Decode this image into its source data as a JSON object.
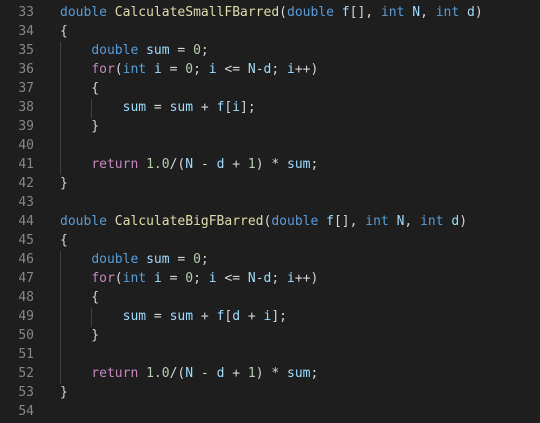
{
  "colors": {
    "background": "#1e1e1e",
    "line_number": "#858585",
    "keyword": "#569cd6",
    "control": "#c586c0",
    "function": "#dcdcaa",
    "variable": "#9cdcfe",
    "number": "#b5cea8",
    "plain": "#d4d4d4"
  },
  "lines": [
    {
      "num": "33",
      "tokens": [
        [
          "double",
          "keyword"
        ],
        [
          " ",
          "plain"
        ],
        [
          "CalculateSmallFBarred",
          "function"
        ],
        [
          "(",
          "plain"
        ],
        [
          "double",
          "keyword"
        ],
        [
          " ",
          "plain"
        ],
        [
          "f",
          "variable"
        ],
        [
          "[], ",
          "plain"
        ],
        [
          "int",
          "keyword"
        ],
        [
          " ",
          "plain"
        ],
        [
          "N",
          "variable"
        ],
        [
          ", ",
          "plain"
        ],
        [
          "int",
          "keyword"
        ],
        [
          " ",
          "plain"
        ],
        [
          "d",
          "variable"
        ],
        [
          ")",
          "plain"
        ]
      ]
    },
    {
      "num": "34",
      "tokens": [
        [
          "{",
          "plain"
        ]
      ]
    },
    {
      "num": "35",
      "tokens": [
        [
          "    ",
          "plain"
        ],
        [
          "double",
          "keyword"
        ],
        [
          " ",
          "plain"
        ],
        [
          "sum",
          "variable"
        ],
        [
          " = ",
          "plain"
        ],
        [
          "0",
          "number"
        ],
        [
          ";",
          "plain"
        ]
      ]
    },
    {
      "num": "36",
      "tokens": [
        [
          "    ",
          "plain"
        ],
        [
          "for",
          "control"
        ],
        [
          "(",
          "plain"
        ],
        [
          "int",
          "keyword"
        ],
        [
          " ",
          "plain"
        ],
        [
          "i",
          "variable"
        ],
        [
          " = ",
          "plain"
        ],
        [
          "0",
          "number"
        ],
        [
          "; ",
          "plain"
        ],
        [
          "i",
          "variable"
        ],
        [
          " <= ",
          "plain"
        ],
        [
          "N",
          "variable"
        ],
        [
          "-",
          "plain"
        ],
        [
          "d",
          "variable"
        ],
        [
          "; ",
          "plain"
        ],
        [
          "i",
          "variable"
        ],
        [
          "++)",
          "plain"
        ]
      ]
    },
    {
      "num": "37",
      "tokens": [
        [
          "    {",
          "plain"
        ]
      ]
    },
    {
      "num": "38",
      "tokens": [
        [
          "        ",
          "plain"
        ],
        [
          "sum",
          "variable"
        ],
        [
          " = ",
          "plain"
        ],
        [
          "sum",
          "variable"
        ],
        [
          " + ",
          "plain"
        ],
        [
          "f",
          "variable"
        ],
        [
          "[",
          "plain"
        ],
        [
          "i",
          "variable"
        ],
        [
          "];",
          "plain"
        ]
      ]
    },
    {
      "num": "39",
      "tokens": [
        [
          "    }",
          "plain"
        ]
      ]
    },
    {
      "num": "40",
      "tokens": []
    },
    {
      "num": "41",
      "tokens": [
        [
          "    ",
          "plain"
        ],
        [
          "return",
          "control"
        ],
        [
          " ",
          "plain"
        ],
        [
          "1.0",
          "number"
        ],
        [
          "/(",
          "plain"
        ],
        [
          "N",
          "variable"
        ],
        [
          " - ",
          "plain"
        ],
        [
          "d",
          "variable"
        ],
        [
          " + ",
          "plain"
        ],
        [
          "1",
          "number"
        ],
        [
          ") * ",
          "plain"
        ],
        [
          "sum",
          "variable"
        ],
        [
          ";",
          "plain"
        ]
      ]
    },
    {
      "num": "42",
      "tokens": [
        [
          "}",
          "plain"
        ]
      ]
    },
    {
      "num": "43",
      "tokens": []
    },
    {
      "num": "44",
      "tokens": [
        [
          "double",
          "keyword"
        ],
        [
          " ",
          "plain"
        ],
        [
          "CalculateBigFBarred",
          "function"
        ],
        [
          "(",
          "plain"
        ],
        [
          "double",
          "keyword"
        ],
        [
          " ",
          "plain"
        ],
        [
          "f",
          "variable"
        ],
        [
          "[], ",
          "plain"
        ],
        [
          "int",
          "keyword"
        ],
        [
          " ",
          "plain"
        ],
        [
          "N",
          "variable"
        ],
        [
          ", ",
          "plain"
        ],
        [
          "int",
          "keyword"
        ],
        [
          " ",
          "plain"
        ],
        [
          "d",
          "variable"
        ],
        [
          ")",
          "plain"
        ]
      ]
    },
    {
      "num": "45",
      "tokens": [
        [
          "{",
          "plain"
        ]
      ]
    },
    {
      "num": "46",
      "tokens": [
        [
          "    ",
          "plain"
        ],
        [
          "double",
          "keyword"
        ],
        [
          " ",
          "plain"
        ],
        [
          "sum",
          "variable"
        ],
        [
          " = ",
          "plain"
        ],
        [
          "0",
          "number"
        ],
        [
          ";",
          "plain"
        ]
      ]
    },
    {
      "num": "47",
      "tokens": [
        [
          "    ",
          "plain"
        ],
        [
          "for",
          "control"
        ],
        [
          "(",
          "plain"
        ],
        [
          "int",
          "keyword"
        ],
        [
          " ",
          "plain"
        ],
        [
          "i",
          "variable"
        ],
        [
          " = ",
          "plain"
        ],
        [
          "0",
          "number"
        ],
        [
          "; ",
          "plain"
        ],
        [
          "i",
          "variable"
        ],
        [
          " <= ",
          "plain"
        ],
        [
          "N",
          "variable"
        ],
        [
          "-",
          "plain"
        ],
        [
          "d",
          "variable"
        ],
        [
          "; ",
          "plain"
        ],
        [
          "i",
          "variable"
        ],
        [
          "++)",
          "plain"
        ]
      ]
    },
    {
      "num": "48",
      "tokens": [
        [
          "    {",
          "plain"
        ]
      ]
    },
    {
      "num": "49",
      "tokens": [
        [
          "        ",
          "plain"
        ],
        [
          "sum",
          "variable"
        ],
        [
          " = ",
          "plain"
        ],
        [
          "sum",
          "variable"
        ],
        [
          " + ",
          "plain"
        ],
        [
          "f",
          "variable"
        ],
        [
          "[",
          "plain"
        ],
        [
          "d",
          "variable"
        ],
        [
          " + ",
          "plain"
        ],
        [
          "i",
          "variable"
        ],
        [
          "];",
          "plain"
        ]
      ]
    },
    {
      "num": "50",
      "tokens": [
        [
          "    }",
          "plain"
        ]
      ]
    },
    {
      "num": "51",
      "tokens": []
    },
    {
      "num": "52",
      "tokens": [
        [
          "    ",
          "plain"
        ],
        [
          "return",
          "control"
        ],
        [
          " ",
          "plain"
        ],
        [
          "1.0",
          "number"
        ],
        [
          "/(",
          "plain"
        ],
        [
          "N",
          "variable"
        ],
        [
          " - ",
          "plain"
        ],
        [
          "d",
          "variable"
        ],
        [
          " + ",
          "plain"
        ],
        [
          "1",
          "number"
        ],
        [
          ") * ",
          "plain"
        ],
        [
          "sum",
          "variable"
        ],
        [
          ";",
          "plain"
        ]
      ]
    },
    {
      "num": "53",
      "tokens": [
        [
          "}",
          "plain"
        ]
      ]
    },
    {
      "num": "54",
      "tokens": []
    }
  ]
}
